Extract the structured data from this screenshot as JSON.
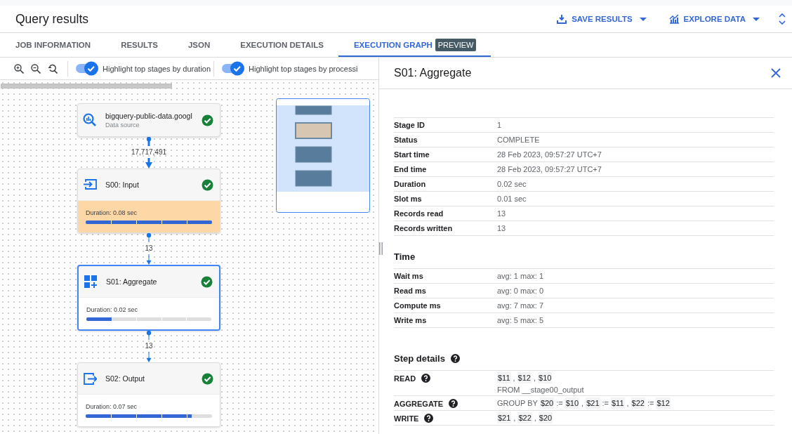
{
  "header": {
    "title": "Query results",
    "actions": [
      {
        "label": "SAVE RESULTS",
        "kind": "save"
      },
      {
        "label": "EXPLORE DATA",
        "kind": "explore"
      }
    ]
  },
  "tabs": [
    {
      "label": "JOB INFORMATION",
      "selected": false
    },
    {
      "label": "RESULTS",
      "selected": false
    },
    {
      "label": "JSON",
      "selected": false
    },
    {
      "label": "EXECUTION DETAILS",
      "selected": false
    },
    {
      "label": "EXECUTION GRAPH",
      "selected": true,
      "badge": "PREVIEW"
    }
  ],
  "toolbar": {
    "toggles": [
      {
        "label": "Highlight top stages by duration",
        "on": true
      },
      {
        "label": "Highlight top stages by processi",
        "on": true
      }
    ]
  },
  "graph": {
    "nodes": [
      {
        "title": "bigquery-public-data.googl",
        "subtitle": "Data source",
        "kind": "source",
        "complete": true,
        "selected": false
      },
      {
        "title": "S00: Input",
        "kind": "input",
        "complete": true,
        "selected": false,
        "highlighted": true,
        "duration": "Duration: 0.08 sec",
        "level": 1
      },
      {
        "title": "S01: Aggregate",
        "kind": "aggregate",
        "complete": true,
        "selected": true,
        "highlighted": false,
        "duration": "Duration: 0.02 sec",
        "level": 0.2
      },
      {
        "title": "S02: Output",
        "kind": "output",
        "complete": true,
        "selected": false,
        "highlighted": false,
        "duration": "Duration: 0.07 sec",
        "level": 0.84
      }
    ],
    "edges": [
      {
        "label": "17,717,491",
        "kind": "heavy"
      },
      {
        "label": "13",
        "kind": "light"
      },
      {
        "label": "13",
        "kind": "light"
      }
    ]
  },
  "details": {
    "title": "S01: Aggregate",
    "properties": [
      {
        "label": "Stage ID",
        "value": "1"
      },
      {
        "label": "Status",
        "value": "COMPLETE"
      },
      {
        "label": "Start time",
        "value": "28 Feb 2023, 09:57:27 UTC+7"
      },
      {
        "label": "End time",
        "value": "28 Feb 2023, 09:57:27 UTC+7"
      },
      {
        "label": "Duration",
        "value": "0.02 sec"
      },
      {
        "label": "Slot ms",
        "value": "0.01 sec"
      },
      {
        "label": "Records read",
        "value": "13"
      },
      {
        "label": "Records written",
        "value": "13"
      }
    ],
    "time": {
      "heading": "Time",
      "rows": [
        {
          "label": "Wait ms",
          "value": "avg: 1 max: 1"
        },
        {
          "label": "Read ms",
          "value": "avg: 0 max: 0"
        },
        {
          "label": "Compute ms",
          "value": "avg: 7 max: 7"
        },
        {
          "label": "Write ms",
          "value": "avg: 5 max: 5"
        }
      ]
    },
    "steps": {
      "heading": "Step details",
      "help": true,
      "rows": [
        {
          "label": "READ",
          "help": true,
          "lines": [
            [
              {
                "text": "$11",
                "kind": "token"
              },
              {
                "text": ",",
                "kind": "plain"
              },
              {
                "text": "$12",
                "kind": "token"
              },
              {
                "text": ",",
                "kind": "plain"
              },
              {
                "text": "$10",
                "kind": "token"
              }
            ],
            [
              {
                "text": "FROM __stage00_output",
                "kind": "plain"
              }
            ]
          ]
        },
        {
          "label": "AGGREGATE",
          "help": true,
          "lines": [
            [
              {
                "text": "GROUP BY",
                "kind": "plain"
              },
              {
                "text": "$20",
                "kind": "token"
              },
              {
                "text": ":=",
                "kind": "plain"
              },
              {
                "text": "$10",
                "kind": "token"
              },
              {
                "text": ",",
                "kind": "plain"
              },
              {
                "text": "$21",
                "kind": "token"
              },
              {
                "text": ":=",
                "kind": "plain"
              },
              {
                "text": "$11",
                "kind": "token"
              },
              {
                "text": ",",
                "kind": "plain"
              },
              {
                "text": "$22",
                "kind": "token"
              },
              {
                "text": ":=",
                "kind": "plain"
              },
              {
                "text": "$12",
                "kind": "token"
              }
            ]
          ]
        },
        {
          "label": "WRITE",
          "help": true,
          "lines": [
            [
              {
                "text": "$21",
                "kind": "token"
              },
              {
                "text": ",",
                "kind": "plain"
              },
              {
                "text": "$22",
                "kind": "token"
              },
              {
                "text": ",",
                "kind": "plain"
              },
              {
                "text": "$20",
                "kind": "token"
              }
            ]
          ]
        }
      ]
    }
  }
}
